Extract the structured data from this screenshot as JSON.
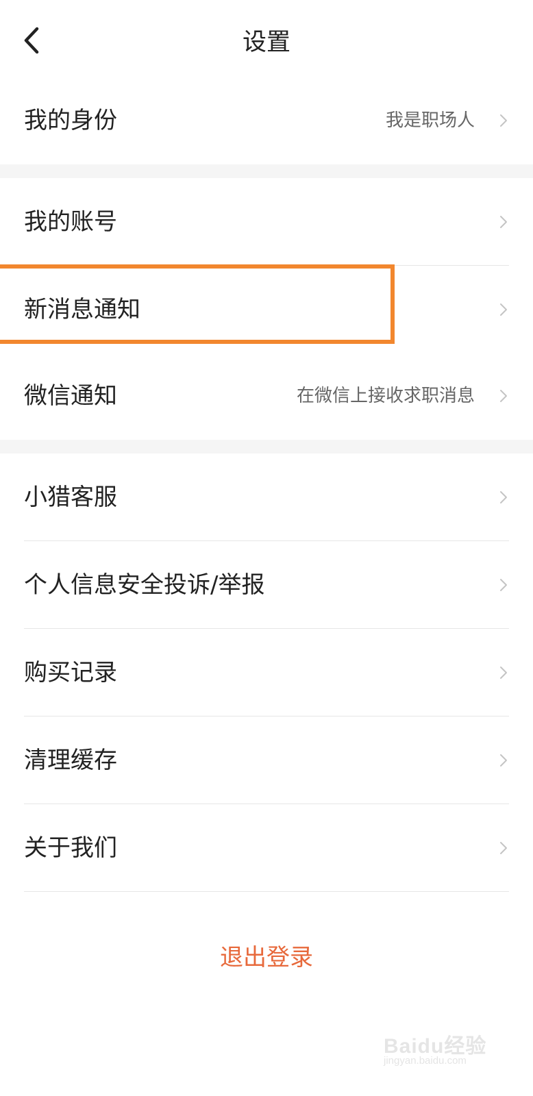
{
  "header": {
    "title": "设置",
    "back_icon": "chevron-left-icon"
  },
  "sections": [
    {
      "rows": [
        {
          "label": "我的身份",
          "value": "我是职场人"
        }
      ]
    },
    {
      "rows": [
        {
          "label": "我的账号",
          "value": ""
        },
        {
          "label": "新消息通知",
          "value": ""
        },
        {
          "label": "微信通知",
          "value": "在微信上接收求职消息"
        }
      ]
    },
    {
      "rows": [
        {
          "label": "小猎客服",
          "value": ""
        },
        {
          "label": "个人信息安全投诉/举报",
          "value": ""
        },
        {
          "label": "购买记录",
          "value": ""
        },
        {
          "label": "清理缓存",
          "value": ""
        },
        {
          "label": "关于我们",
          "value": ""
        }
      ]
    }
  ],
  "logout": {
    "label": "退出登录"
  },
  "colors": {
    "accent": "#e7693b",
    "highlight": "#f2872e",
    "text": "#222222",
    "secondary_text": "#666666",
    "divider": "#e6e6e6",
    "section_gap": "#f5f5f5"
  },
  "watermark": {
    "text": "Baidu经验",
    "sub": "jingyan.baidu.com"
  }
}
